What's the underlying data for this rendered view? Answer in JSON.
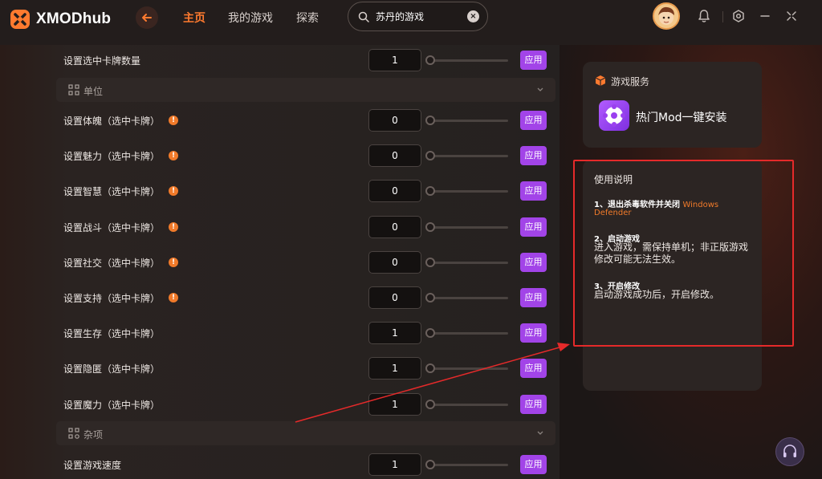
{
  "app": {
    "logo_text": "XMODhub",
    "brand_color": "#ff7a2f",
    "accent_purple": "#a244e8"
  },
  "header": {
    "nav": [
      {
        "label": "主页",
        "active": true
      },
      {
        "label": "我的游戏",
        "active": false
      },
      {
        "label": "探索",
        "active": false
      }
    ],
    "search_value": "苏丹的游戏",
    "icons": [
      "back-arrow-icon",
      "search-icon",
      "clear-icon",
      "bell-icon",
      "settings-icon",
      "minimize-icon",
      "close-icon"
    ]
  },
  "rows_top": [
    {
      "label": "设置选中卡牌数量",
      "value": "1",
      "apply": "应用",
      "info": false
    }
  ],
  "sections": [
    {
      "label": "单位"
    },
    {
      "label": "杂项"
    }
  ],
  "unit_rows": [
    {
      "label": "设置体魄（选中卡牌）",
      "value": "0",
      "apply": "应用",
      "info": true
    },
    {
      "label": "设置魅力（选中卡牌）",
      "value": "0",
      "apply": "应用",
      "info": true
    },
    {
      "label": "设置智慧（选中卡牌）",
      "value": "0",
      "apply": "应用",
      "info": true
    },
    {
      "label": "设置战斗（选中卡牌）",
      "value": "0",
      "apply": "应用",
      "info": true
    },
    {
      "label": "设置社交（选中卡牌）",
      "value": "0",
      "apply": "应用",
      "info": true
    },
    {
      "label": "设置支持（选中卡牌）",
      "value": "0",
      "apply": "应用",
      "info": true
    },
    {
      "label": "设置生存（选中卡牌）",
      "value": "1",
      "apply": "应用",
      "info": false
    },
    {
      "label": "设置隐匿（选中卡牌）",
      "value": "1",
      "apply": "应用",
      "info": false
    },
    {
      "label": "设置魔力（选中卡牌）",
      "value": "1",
      "apply": "应用",
      "info": false
    }
  ],
  "misc_rows": [
    {
      "label": "设置游戏速度",
      "value": "1",
      "apply": "应用",
      "info": false
    }
  ],
  "service": {
    "title": "游戏服务",
    "mod_label": "热门Mod一键安装"
  },
  "usage": {
    "title": "使用说明",
    "step1_head": "1、退出杀毒软件并关闭",
    "step1_orange_a": "Windows",
    "step1_orange_b": "Defender",
    "step2_head": "2、启动游戏",
    "step2_body": "进入游戏，需保持单机；非正版游戏修改可能无法生效。",
    "step3_head": "3、开启修改",
    "step3_body": "启动游戏成功后，开启修改。"
  }
}
